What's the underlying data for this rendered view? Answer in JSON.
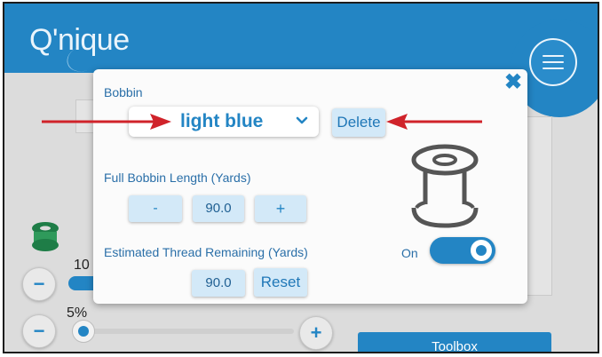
{
  "app": {
    "logo_text": "Q'nique"
  },
  "dialog": {
    "bobbin_label": "Bobbin",
    "selected_bobbin": "light blue",
    "delete_label": "Delete",
    "full_length_label": "Full Bobbin Length (Yards)",
    "decrement_label": "-",
    "full_length_value": "90.0",
    "increment_label": "+",
    "remaining_label": "Estimated Thread Remaining (Yards)",
    "remaining_value": "90.0",
    "reset_label": "Reset",
    "toggle_label": "On",
    "toggle_on": true
  },
  "background": {
    "percent_top": "10 .",
    "percent_bottom": "5%",
    "minus_label": "−",
    "plus_label": "+",
    "toolbox_label": "Toolbox"
  },
  "colors": {
    "accent": "#2385c4",
    "arrow": "#d0232a",
    "button_fill": "#d3e9f8"
  },
  "icons": [
    "menu-icon",
    "close-icon",
    "chevron-down-icon",
    "spool-icon",
    "bobbin-icon"
  ]
}
